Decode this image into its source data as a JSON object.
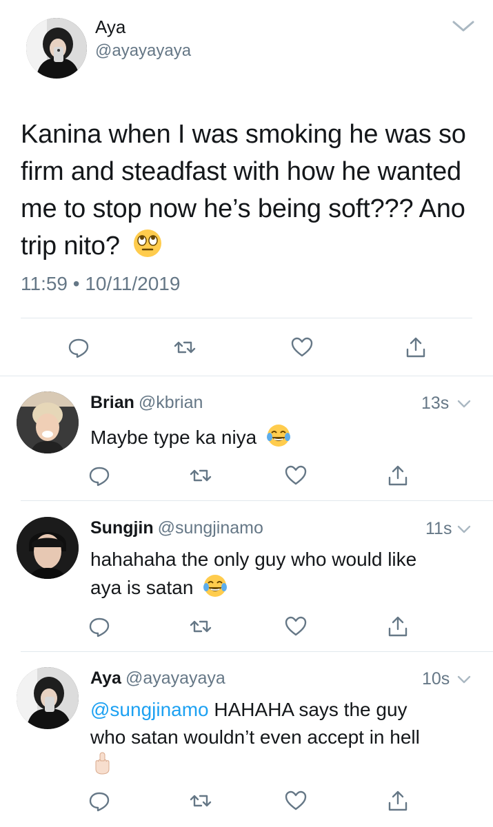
{
  "main_tweet": {
    "name": "Aya",
    "handle": "@ayayayaya",
    "text": "Kanina when I was smoking he was so firm and steadfast with how he wanted me to stop now he’s being soft??? Ano trip nito?",
    "emoji": "rolling-eyes",
    "timestamp": "11:59 • 10/11/2019"
  },
  "replies": [
    {
      "name": "Brian",
      "handle": "@kbrian",
      "time": "13s",
      "text": "Maybe type ka niya",
      "emoji": "tears-of-joy"
    },
    {
      "name": "Sungjin",
      "handle": "@sungjinamo",
      "time": "11s",
      "text_line1": "hahahaha the only guy who would like",
      "text_line2": "aya is satan",
      "emoji": "tears-of-joy"
    },
    {
      "name": "Aya",
      "handle": "@ayayayaya",
      "time": "10s",
      "mention": "@sungjinamo",
      "text_after_mention": " HAHAHA says the guy",
      "text_line2": "who satan wouldn’t even accept in hell",
      "emoji": "middle-finger"
    }
  ],
  "colors": {
    "text": "#14171a",
    "secondary": "#657786",
    "divider": "#e1e8ed",
    "mention": "#1da1f2"
  }
}
